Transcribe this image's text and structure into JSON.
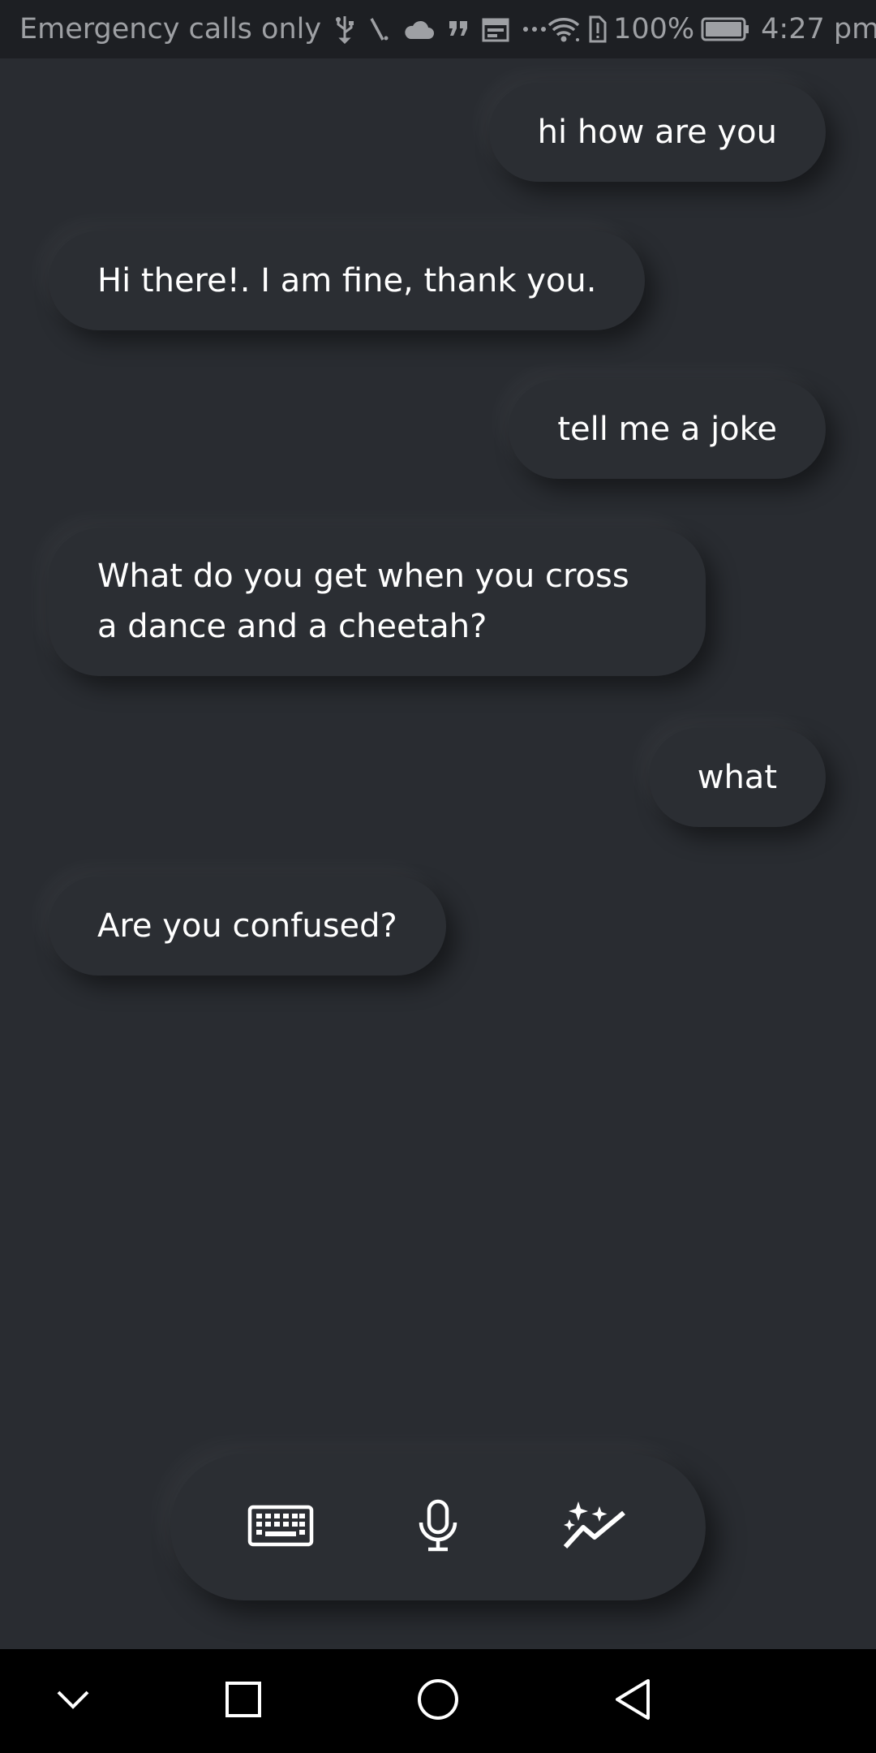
{
  "status_bar": {
    "carrier_text": "Emergency calls only",
    "battery_percent": "100%",
    "time": "4:27 pm",
    "left_icons": [
      "usb-icon",
      "signal-icon",
      "cloud-icon",
      "quote-icon",
      "calendar-icon",
      "more-icon"
    ],
    "right_icons": [
      "wifi-icon",
      "battery-alert-icon",
      "battery-icon"
    ]
  },
  "messages": [
    {
      "sender": "user",
      "text": "hi how are you"
    },
    {
      "sender": "bot",
      "text": "Hi there!. I am fine, thank you."
    },
    {
      "sender": "user",
      "text": "tell me a joke"
    },
    {
      "sender": "bot",
      "text": "What do you get when you cross a dance and a cheetah?"
    },
    {
      "sender": "user",
      "text": "what"
    },
    {
      "sender": "bot",
      "text": "Are you confused?"
    }
  ],
  "action_bar": {
    "buttons": [
      "keyboard-icon",
      "microphone-icon",
      "sparkle-chart-icon"
    ]
  },
  "nav_bar": {
    "buttons": [
      "chevron-down-icon",
      "recents-square-icon",
      "home-circle-icon",
      "back-triangle-icon"
    ]
  },
  "colors": {
    "background": "#292c31",
    "bubble": "#2b2e33",
    "text": "#ffffff",
    "status_bar": "#1d1f23",
    "nav_bar": "#000000"
  }
}
